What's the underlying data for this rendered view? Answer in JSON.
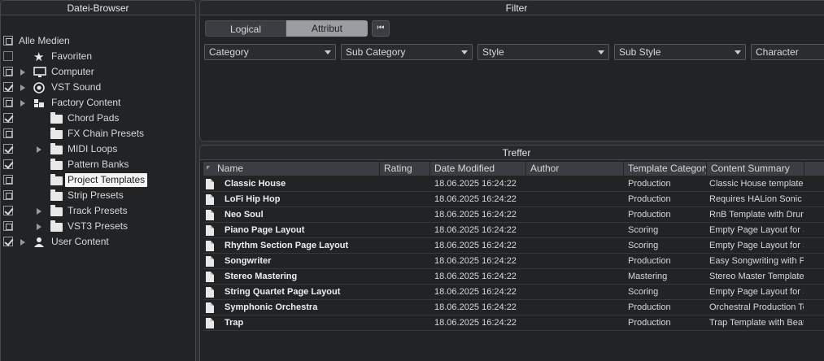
{
  "left_panel": {
    "title": "Datei-Browser",
    "tree": [
      {
        "label": "Alle Medien",
        "checkbox": "partial",
        "icon": "none",
        "expander": false,
        "indent": 0
      },
      {
        "label": "Favoriten",
        "checkbox": "empty",
        "icon": "star-icon",
        "expander": false,
        "indent": 1
      },
      {
        "label": "Computer",
        "checkbox": "partial",
        "icon": "monitor-icon",
        "expander": true,
        "indent": 1
      },
      {
        "label": "VST Sound",
        "checkbox": "checked",
        "icon": "vst-sound-icon",
        "expander": true,
        "indent": 1
      },
      {
        "label": "Factory Content",
        "checkbox": "partial",
        "icon": "factory-content-icon",
        "expander": true,
        "indent": 1
      },
      {
        "label": "Chord Pads",
        "checkbox": "checked",
        "icon": "folder-icon",
        "expander": false,
        "indent": 2
      },
      {
        "label": "FX Chain Presets",
        "checkbox": "partial",
        "icon": "folder-icon",
        "expander": false,
        "indent": 2
      },
      {
        "label": "MIDI Loops",
        "checkbox": "checked",
        "icon": "folder-icon",
        "expander": true,
        "indent": 2
      },
      {
        "label": "Pattern Banks",
        "checkbox": "checked",
        "icon": "folder-icon",
        "expander": false,
        "indent": 2
      },
      {
        "label": "Project Templates",
        "checkbox": "partial",
        "icon": "folder-icon",
        "expander": false,
        "indent": 2,
        "selected": true
      },
      {
        "label": "Strip Presets",
        "checkbox": "partial",
        "icon": "folder-icon",
        "expander": false,
        "indent": 2
      },
      {
        "label": "Track Presets",
        "checkbox": "checked",
        "icon": "folder-icon",
        "expander": true,
        "indent": 2
      },
      {
        "label": "VST3 Presets",
        "checkbox": "partial",
        "icon": "folder-icon",
        "expander": true,
        "indent": 2
      },
      {
        "label": "User Content",
        "checkbox": "checked",
        "icon": "user-icon",
        "expander": true,
        "indent": 1
      }
    ]
  },
  "filter_panel": {
    "title": "Filter",
    "mode_tabs": {
      "logical": "Logical",
      "attribut": "Attribut",
      "active": "attribut"
    },
    "reset_icon": "rewind-icon",
    "reset_glyph": "⏮",
    "dropdowns": [
      "Category",
      "Sub Category",
      "Style",
      "Sub Style",
      "Character"
    ]
  },
  "results_panel": {
    "title": "Treffer",
    "columns": [
      "Name",
      "Rating",
      "Date Modified",
      "Author",
      "Template Category",
      "Content Summary"
    ],
    "rows": [
      {
        "name": "Classic House",
        "rating": "",
        "date": "18.06.2025 16:24:22",
        "author": "",
        "category": "Production",
        "summary": "Classic House template"
      },
      {
        "name": "LoFi Hip Hop",
        "rating": "",
        "date": "18.06.2025 16:24:22",
        "author": "",
        "category": "Production",
        "summary": "Requires HALion Sonic v"
      },
      {
        "name": "Neo Soul",
        "rating": "",
        "date": "18.06.2025 16:24:22",
        "author": "",
        "category": "Production",
        "summary": "RnB Template with Drum"
      },
      {
        "name": "Piano Page Layout",
        "rating": "",
        "date": "18.06.2025 16:24:22",
        "author": "",
        "category": "Scoring",
        "summary": "Empty Page Layout for S"
      },
      {
        "name": "Rhythm Section Page Layout",
        "rating": "",
        "date": "18.06.2025 16:24:22",
        "author": "",
        "category": "Scoring",
        "summary": "Empty Page Layout for S"
      },
      {
        "name": "Songwriter",
        "rating": "",
        "date": "18.06.2025 16:24:22",
        "author": "",
        "category": "Production",
        "summary": "Easy Songwriting with P"
      },
      {
        "name": "Stereo Mastering",
        "rating": "",
        "date": "18.06.2025 16:24:22",
        "author": "",
        "category": "Mastering",
        "summary": "Stereo Master Template"
      },
      {
        "name": "String Quartet Page Layout",
        "rating": "",
        "date": "18.06.2025 16:24:22",
        "author": "",
        "category": "Scoring",
        "summary": "Empty Page Layout for S"
      },
      {
        "name": "Symphonic Orchestra",
        "rating": "",
        "date": "18.06.2025 16:24:22",
        "author": "",
        "category": "Production",
        "summary": "Orchestral Production Te"
      },
      {
        "name": "Trap",
        "rating": "",
        "date": "18.06.2025 16:24:22",
        "author": "",
        "category": "Production",
        "summary": "Trap Template with Beat"
      }
    ]
  },
  "colors": {
    "background": "#212325",
    "border": "#44474b",
    "header": "#3a3d41",
    "selected_label_bg": "#f4f4f4"
  }
}
